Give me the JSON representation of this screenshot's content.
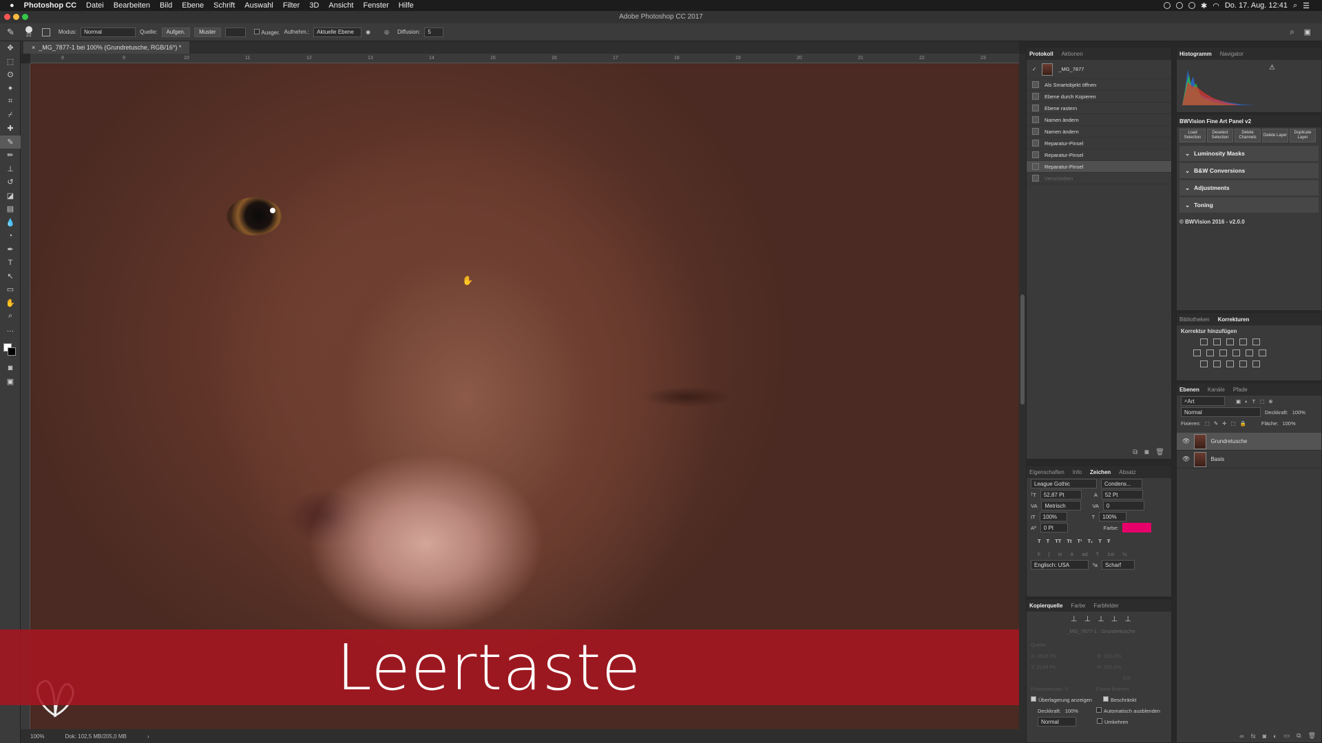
{
  "menubar": {
    "apple": "",
    "app": "Photoshop CC",
    "items": [
      "Datei",
      "Bearbeiten",
      "Bild",
      "Ebene",
      "Schrift",
      "Auswahl",
      "Filter",
      "3D",
      "Ansicht",
      "Fenster",
      "Hilfe"
    ],
    "datetime": "Do. 17. Aug. 12:41"
  },
  "window": {
    "title": "Adobe Photoshop CC 2017"
  },
  "options": {
    "brush_size": "22",
    "modus_label": "Modus:",
    "modus_value": "Normal",
    "quelle_label": "Quelle:",
    "source_btn": "Aufgen.",
    "pattern_btn": "Muster",
    "aligned_label": "Ausger.",
    "sample_label": "Aufnehm.:",
    "sample_value": "Aktuelle Ebene",
    "diffusion_label": "Diffusion:",
    "diffusion_value": "5"
  },
  "document": {
    "tab": "_MG_7877-1 bei 100% (Grundretusche, RGB/16*) *",
    "zoom": "100%",
    "doc_info": "Dok: 102,5 MB/205,0 MB",
    "ruler_ticks": [
      "8",
      "9",
      "10",
      "11",
      "12",
      "13",
      "14",
      "15",
      "16",
      "17",
      "18",
      "19",
      "20",
      "21",
      "22",
      "23"
    ]
  },
  "banner": {
    "text": "Leertaste"
  },
  "history": {
    "tabs": [
      "Protokoll",
      "Aktionen"
    ],
    "snapshot": "_MG_7877",
    "items": [
      {
        "label": "Als Smartobjekt öffnen",
        "state": "normal"
      },
      {
        "label": "Ebene durch Kopieren",
        "state": "normal"
      },
      {
        "label": "Ebene rastern",
        "state": "normal"
      },
      {
        "label": "Namen ändern",
        "state": "normal"
      },
      {
        "label": "Namen ändern",
        "state": "normal"
      },
      {
        "label": "Reparatur-Pinsel",
        "state": "normal"
      },
      {
        "label": "Reparatur-Pinsel",
        "state": "normal"
      },
      {
        "label": "Reparatur-Pinsel",
        "state": "selected"
      },
      {
        "label": "Verschieben",
        "state": "dim"
      }
    ]
  },
  "histogram": {
    "tabs": [
      "Histogramm",
      "Navigator"
    ]
  },
  "bwvision": {
    "title": "BWVision Fine Art Panel v2",
    "buttons": [
      "Load Selection",
      "Deselect Selection",
      "Delete Channels",
      "Delete Layer",
      "Duplicate Layer"
    ],
    "sections": [
      "Luminosity Masks",
      "B&W Conversions",
      "Adjustments",
      "Toning"
    ],
    "footer": "© BWVision 2016 - v2.0.0"
  },
  "corrections": {
    "tabs": [
      "Bibliotheken",
      "Korrekturen"
    ],
    "heading": "Korrektur hinzufügen"
  },
  "layers": {
    "tabs": [
      "Ebenen",
      "Kanäle",
      "Pfade"
    ],
    "filter": "Art",
    "blend": "Normal",
    "opacity_label": "Deckkraft:",
    "opacity": "100%",
    "lock_label": "Fixieren:",
    "fill_label": "Fläche:",
    "fill": "100%",
    "items": [
      {
        "name": "Grundretusche",
        "selected": true
      },
      {
        "name": "Basis",
        "selected": false
      }
    ]
  },
  "character": {
    "tabs": [
      "Eigenschaften",
      "Info",
      "Zeichen",
      "Absatz"
    ],
    "font": "League Gothic",
    "style": "Condens...",
    "size": "52,87 Pt",
    "leading": "52 Pt",
    "kerning": "Metrisch",
    "tracking": "0",
    "vscale": "100%",
    "hscale": "100%",
    "baseline": "0 Pt",
    "color_label": "Farbe:",
    "color": "#e8006a",
    "language": "Englisch: USA",
    "antialias": "Scharf",
    "styles": [
      "T",
      "T",
      "TT",
      "Tt",
      "T¹",
      "T₁",
      "T",
      "Ŧ"
    ]
  },
  "clone": {
    "tabs": [
      "Kopierquelle",
      "Farbe",
      "Farbfelder"
    ],
    "source_name": "_MG_7877-1 : Grundretusche",
    "offset_label": "Quelle:",
    "x": "X: 2918 Px",
    "y": "Y: 2143 Px",
    "w": "B: 100,0%",
    "h": "H: 100,0%",
    "angle": "0,0",
    "frame_offset": "Frameversatz: 0",
    "lock_frame": "Frame fixieren",
    "show_overlay": "Überlagerung anzeigen",
    "clipped": "Beschränkt",
    "opacity_label": "Deckkraft:",
    "opacity": "100%",
    "auto_hide": "Automatisch ausblenden",
    "mode": "Normal",
    "invert": "Umkehren"
  },
  "colors": {
    "banner": "#a61620",
    "accent_pink": "#e8006a"
  }
}
